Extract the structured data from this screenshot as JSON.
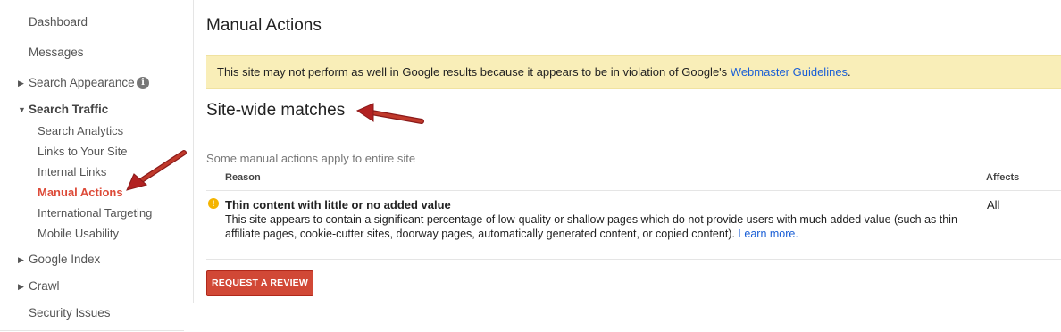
{
  "sidebar": {
    "items": [
      {
        "label": "Dashboard"
      },
      {
        "label": "Messages"
      },
      {
        "label": "Search Appearance",
        "info_icon": "i"
      },
      {
        "label": "Search Traffic"
      },
      {
        "label": "Google Index"
      },
      {
        "label": "Crawl"
      },
      {
        "label": "Security Issues"
      }
    ],
    "search_traffic_children": [
      {
        "label": "Search Analytics"
      },
      {
        "label": "Links to Your Site"
      },
      {
        "label": "Internal Links"
      },
      {
        "label": "Manual Actions",
        "active": true
      },
      {
        "label": "International Targeting"
      },
      {
        "label": "Mobile Usability"
      }
    ]
  },
  "main": {
    "title": "Manual Actions",
    "alert": {
      "text": "This site may not perform as well in Google results because it appears to be in violation of Google's ",
      "link": "Webmaster Guidelines",
      "suffix": "."
    },
    "section_title": "Site-wide matches",
    "section_subtitle": "Some manual actions apply to entire site",
    "table": {
      "headers": {
        "reason": "Reason",
        "affects": "Affects"
      },
      "rows": [
        {
          "title": "Thin content with little or no added value",
          "description": "This site appears to contain a significant percentage of low-quality or shallow pages which do not provide users with much added value (such as thin affiliate pages, cookie-cutter sites, doorway pages, automatically generated content, or copied content). ",
          "link": "Learn more.",
          "affects": "All"
        }
      ]
    },
    "review_button": "REQUEST A REVIEW"
  },
  "colors": {
    "active_nav": "#dd4b39",
    "alert_bg": "#f9eeb8",
    "link": "#1a5fd6",
    "button": "#d14836",
    "annotation_arrow": "#b22222"
  },
  "icons": {
    "expanded": "caret-down-icon",
    "collapsed": "caret-right-icon",
    "info": "info-icon",
    "warning": "warning-icon",
    "annotation": "red-arrow-icon"
  }
}
